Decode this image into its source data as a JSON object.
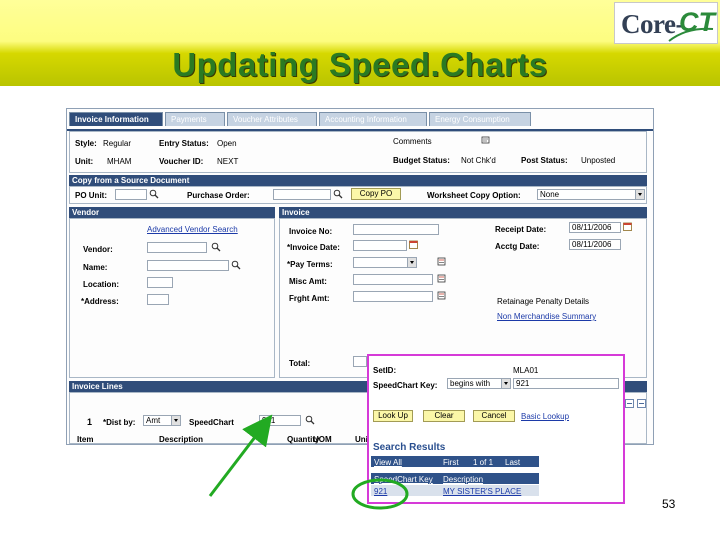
{
  "slide": {
    "title": "Updating Speed.Charts",
    "page_number": "53",
    "logo": {
      "core": "Core-",
      "ct": "CT"
    }
  },
  "tabs": [
    {
      "label": "Invoice Information",
      "active": true
    },
    {
      "label": "Payments",
      "active": false
    },
    {
      "label": "Voucher Attributes",
      "active": false
    },
    {
      "label": "Accounting Information",
      "active": false
    },
    {
      "label": "Energy Consumption",
      "active": false
    }
  ],
  "header": {
    "style_label": "Style:",
    "style_value": "Regular",
    "entry_status_label": "Entry Status:",
    "entry_status_value": "Open",
    "comments_label": "Comments",
    "unit_label": "Unit:",
    "unit_value": "MHAM",
    "voucher_id_label": "Voucher ID:",
    "voucher_id_value": "NEXT",
    "budget_status_label": "Budget Status:",
    "budget_status_value": "Not Chk'd",
    "post_status_label": "Post Status:",
    "post_status_value": "Unposted"
  },
  "copy_source": {
    "section_title": "Copy from a Source Document",
    "po_unit_label": "PO Unit:",
    "purchase_order_label": "Purchase Order:",
    "copy_po_button": "Copy PO",
    "worksheet_label": "Worksheet Copy Option:",
    "worksheet_value": "None"
  },
  "vendor": {
    "section_title": "Vendor",
    "advanced_search_link": "Advanced Vendor Search",
    "vendor_label": "Vendor:",
    "name_label": "Name:",
    "location_label": "Location:",
    "address_label": "*Address:"
  },
  "invoice": {
    "section_title": "Invoice",
    "invoice_no_label": "Invoice No:",
    "invoice_date_label": "*Invoice Date:",
    "pay_terms_label": "*Pay Terms:",
    "misc_amt_label": "Misc Amt:",
    "frght_amt_label": "Frght Amt:",
    "total_label": "Total:",
    "receipt_date_label": "Receipt Date:",
    "receipt_date_value": "08/11/2006",
    "acctg_date_label": "Acctg Date:",
    "acctg_date_value": "08/11/2006",
    "retainage_text": "Retainage Penalty Details",
    "non_merch_link": "Non Merchandise Summary"
  },
  "invoice_lines": {
    "section_title": "Invoice Lines",
    "line_number": "1",
    "dist_by_label": "*Dist by:",
    "dist_by_value": "Amt",
    "speedchart_label": "SpeedChart",
    "speedchart_value": "921",
    "columns": [
      "Item",
      "Description",
      "Quantity",
      "UOM",
      "Uni"
    ]
  },
  "popup": {
    "setid_label": "SetID:",
    "setid_value": "MLA01",
    "key_label": "SpeedChart Key:",
    "operator_value": "begins with",
    "key_value": "921",
    "lookup_button": "Look Up",
    "clear_button": "Clear",
    "cancel_button": "Cancel",
    "basic_lookup_link": "Basic Lookup",
    "results_title": "Search Results",
    "nav_view_all": "View All",
    "nav_first": "First",
    "nav_range": "1 of 1",
    "nav_last": "Last",
    "columns": [
      "SpeedChart Key",
      "Description"
    ],
    "rows": [
      {
        "key": "921",
        "description": "MY SISTER'S PLACE"
      }
    ]
  },
  "colors": {
    "title_green": "#2a7a22",
    "header_yellow": "#fdfd80",
    "peoplesoft_blue": "#304d7a",
    "popup_border": "#d63ad8",
    "annotation_green": "#22aa22"
  }
}
